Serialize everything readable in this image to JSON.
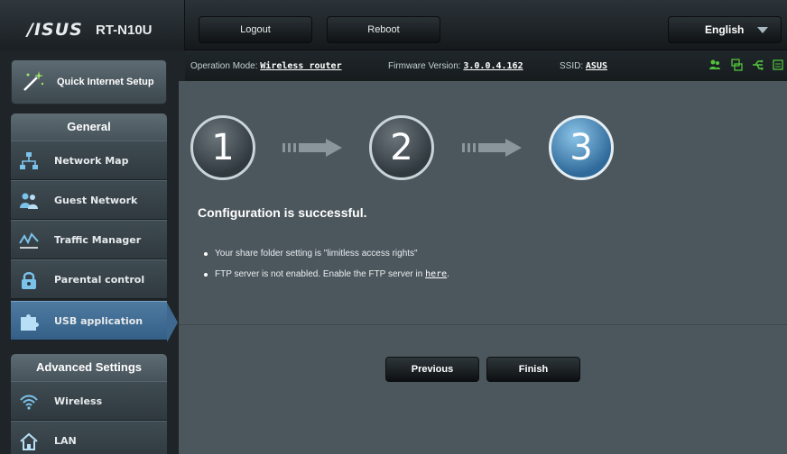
{
  "header": {
    "brand": "/ISUS",
    "model": "RT-N10U",
    "logout_label": "Logout",
    "reboot_label": "Reboot",
    "language": "English"
  },
  "status": {
    "mode_label": "Operation Mode:",
    "mode_value": "Wireless router",
    "firmware_label": "Firmware Version:",
    "firmware_value": "3.0.0.4.162",
    "ssid_label": "SSID:",
    "ssid_value": "ASUS"
  },
  "sidebar": {
    "quick_setup": "Quick Internet Setup",
    "general_title": "General",
    "general_items": [
      {
        "label": "Network Map",
        "icon": "network-map-icon"
      },
      {
        "label": "Guest Network",
        "icon": "guest-network-icon"
      },
      {
        "label": "Traffic Manager",
        "icon": "traffic-manager-icon"
      },
      {
        "label": "Parental control",
        "icon": "parental-control-icon"
      },
      {
        "label": "USB application",
        "icon": "usb-application-icon",
        "active": true
      }
    ],
    "advanced_title": "Advanced Settings",
    "advanced_items": [
      {
        "label": "Wireless",
        "icon": "wireless-icon"
      },
      {
        "label": "LAN",
        "icon": "lan-icon"
      }
    ]
  },
  "wizard": {
    "steps": [
      "1",
      "2",
      "3"
    ],
    "current_step": 3,
    "title": "Configuration is successful.",
    "bullets": [
      {
        "text": "Your share folder setting is \"limitless access rights\""
      },
      {
        "text": "FTP server is not enabled. Enable the FTP server in ",
        "link": "here",
        "suffix": "."
      }
    ],
    "previous_label": "Previous",
    "finish_label": "Finish"
  },
  "colors": {
    "accent": "#3e6890",
    "panel": "#4c575d",
    "status_green": "#52c23a"
  }
}
